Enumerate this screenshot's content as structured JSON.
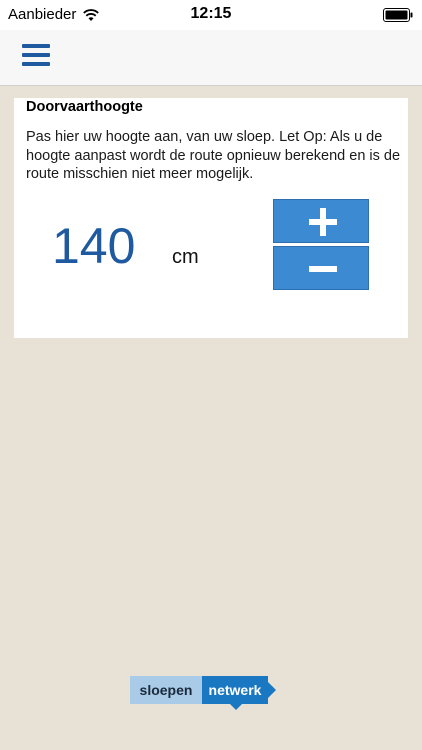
{
  "status_bar": {
    "carrier": "Aanbieder",
    "time": "12:15",
    "wifi_icon": "wifi-icon",
    "battery_icon": "battery-icon"
  },
  "nav": {
    "menu_icon": "hamburger-menu-icon"
  },
  "card": {
    "title": "Doorvaarthoogte",
    "description": "Pas hier uw hoogte aan, van uw sloep. Let Op: Als u de hoogte aanpast wordt de route opnieuw berekend en is de route misschien niet meer mogelijk.",
    "value": "140",
    "unit": "cm",
    "plus_icon": "plus-icon",
    "minus_icon": "minus-icon"
  },
  "logo": {
    "left_text": "sloepen",
    "right_text": "netwerk"
  },
  "colors": {
    "background": "#e8e2d6",
    "accent_blue": "#3c8bd2",
    "value_blue": "#1f5aa0",
    "menu_blue": "#1f5aa0",
    "logo_light": "#a9cbe8",
    "logo_dark": "#1a78c2"
  }
}
